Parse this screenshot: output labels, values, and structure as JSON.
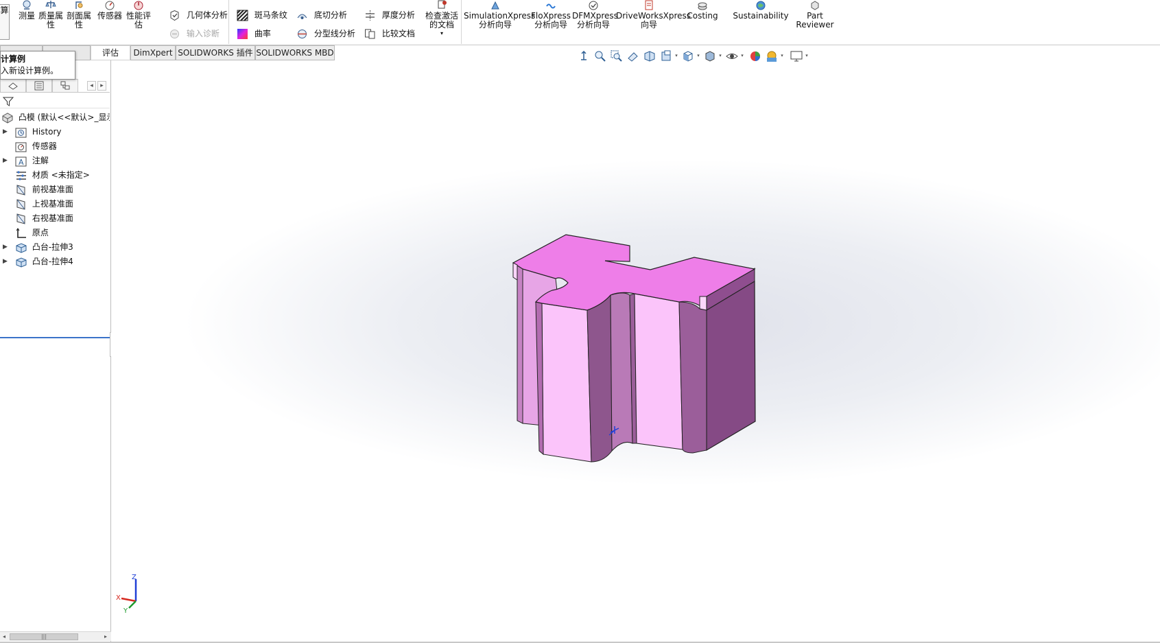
{
  "ribbon": {
    "partial_left_label": "算",
    "large_buttons": [
      {
        "label": "测量",
        "icon": "measure-icon"
      },
      {
        "label": "质量属\n性",
        "icon": "mass-properties-icon"
      },
      {
        "label": "剖面属\n性",
        "icon": "section-properties-icon"
      },
      {
        "label": "传感器",
        "icon": "sensor-icon"
      },
      {
        "label": "性能评\n估",
        "icon": "performance-evaluation-icon"
      }
    ],
    "small_buttons": [
      {
        "label": "几何体分析",
        "icon": "geometry-analysis-icon",
        "disabled": false
      },
      {
        "label": "输入诊断",
        "icon": "import-diagnostics-icon",
        "disabled": true
      },
      {
        "label": "斑马条纹",
        "icon": "zebra-stripes-icon",
        "disabled": false
      },
      {
        "label": "曲率",
        "icon": "curvature-icon",
        "disabled": false
      },
      {
        "label": "底切分析",
        "icon": "undercut-analysis-icon",
        "disabled": false
      },
      {
        "label": "分型线分析",
        "icon": "parting-line-analysis-icon",
        "disabled": false
      },
      {
        "label": "厚度分析",
        "icon": "thickness-analysis-icon",
        "disabled": false
      },
      {
        "label": "比较文档",
        "icon": "compare-documents-icon",
        "disabled": false
      }
    ],
    "check_active_doc": {
      "label": "检查激活\n的文档",
      "icon": "check-active-document-icon"
    },
    "xpress_buttons": [
      {
        "label": "SimulationXpress\n分析向导",
        "icon": "simulationxpress-icon"
      },
      {
        "label": "FloXpress\n分析向导",
        "icon": "floxpress-icon"
      },
      {
        "label": "DFMXpress\n分析向导",
        "icon": "dfmxpress-icon"
      },
      {
        "label": "DriveWorksXpress\n向导",
        "icon": "driveworksxpress-icon"
      },
      {
        "label": "Costing",
        "icon": "costing-icon"
      },
      {
        "label": "Sustainability",
        "icon": "sustainability-icon"
      },
      {
        "label": "Part\nReviewer",
        "icon": "part-reviewer-icon"
      }
    ]
  },
  "tabs": [
    {
      "label": "评估",
      "active": true
    },
    {
      "label": "DimXpert",
      "active": false
    },
    {
      "label": "SOLIDWORKS 插件",
      "active": false
    },
    {
      "label": "SOLIDWORKS MBD",
      "active": false
    }
  ],
  "tooltip": {
    "title": "计算例",
    "description": "入新设计算例。"
  },
  "feature_tree": {
    "root_label": "凸模 (默认<<默认>_显示",
    "items": [
      {
        "label": "History",
        "icon": "history-folder-icon",
        "expandable": true
      },
      {
        "label": "传感器",
        "icon": "sensor-folder-icon",
        "expandable": false
      },
      {
        "label": "注解",
        "icon": "annotations-icon",
        "expandable": true
      },
      {
        "label": "材质 <未指定>",
        "icon": "material-icon",
        "expandable": false
      },
      {
        "label": "前视基准面",
        "icon": "plane-icon",
        "expandable": false
      },
      {
        "label": "上视基准面",
        "icon": "plane-icon",
        "expandable": false
      },
      {
        "label": "右视基准面",
        "icon": "plane-icon",
        "expandable": false
      },
      {
        "label": "原点",
        "icon": "origin-icon",
        "expandable": false
      },
      {
        "label": "凸台-拉伸3",
        "icon": "boss-extrude-icon",
        "expandable": true
      },
      {
        "label": "凸台-拉伸4",
        "icon": "boss-extrude-icon",
        "expandable": true
      }
    ]
  },
  "triad": {
    "x": "X",
    "y": "Y",
    "z": "Z"
  },
  "colors": {
    "model_top": "#ee7ee8",
    "model_front_light": "#fbc4fa",
    "model_mid": "#c97ec6",
    "model_dark": "#854a85",
    "accent": "#3a73c9"
  }
}
